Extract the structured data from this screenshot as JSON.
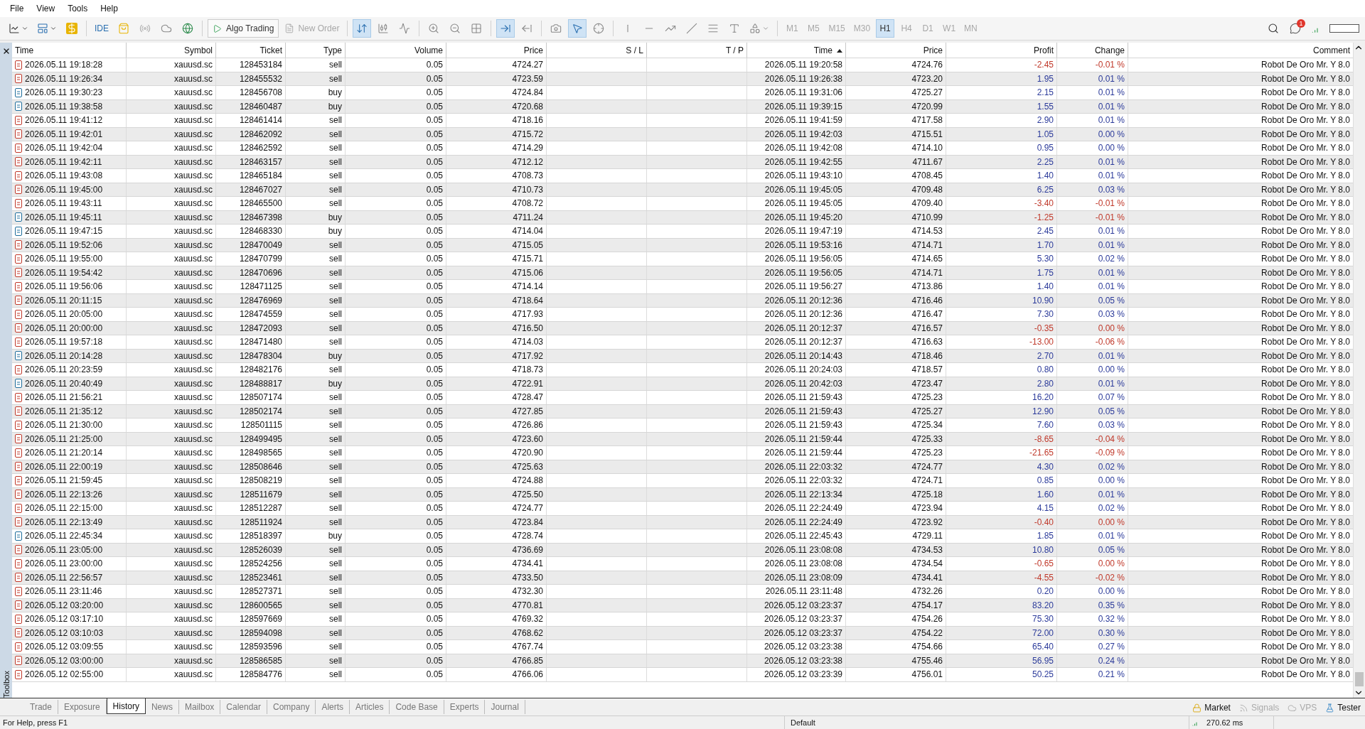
{
  "menu": [
    "File",
    "View",
    "Tools",
    "Help"
  ],
  "toolbar": {
    "ide": "IDE",
    "algo_trading": "Algo Trading",
    "new_order": {
      "label": "New Order",
      "disabled": true
    },
    "timeframes": [
      {
        "label": "M1",
        "selected": false
      },
      {
        "label": "M5",
        "selected": false
      },
      {
        "label": "M15",
        "selected": false
      },
      {
        "label": "M30",
        "selected": false
      },
      {
        "label": "H1",
        "selected": true
      },
      {
        "label": "H4",
        "selected": false
      },
      {
        "label": "D1",
        "selected": false
      },
      {
        "label": "W1",
        "selected": false
      },
      {
        "label": "MN",
        "selected": false
      }
    ],
    "notification_badge": "1"
  },
  "toolbox_label": "Toolbox",
  "table": {
    "columns": [
      {
        "label": "Time",
        "sorted": false
      },
      {
        "label": "Symbol",
        "sorted": false
      },
      {
        "label": "Ticket",
        "sorted": false
      },
      {
        "label": "Type",
        "sorted": false
      },
      {
        "label": "Volume",
        "sorted": false
      },
      {
        "label": "Price",
        "sorted": false
      },
      {
        "label": "S / L",
        "sorted": false
      },
      {
        "label": "T / P",
        "sorted": false
      },
      {
        "label": "Time",
        "sorted": true
      },
      {
        "label": "Price",
        "sorted": false
      },
      {
        "label": "Profit",
        "sorted": false
      },
      {
        "label": "Change",
        "sorted": false
      },
      {
        "label": "Comment",
        "sorted": false
      }
    ],
    "rows": [
      {
        "kind": "sell",
        "open_time": "2026.05.11 19:18:28",
        "symbol": "xauusd.sc",
        "ticket": "128453184",
        "type": "sell",
        "volume": "0.05",
        "open_price": "4724.27",
        "close_time": "2026.05.11 19:20:58",
        "close_price": "4724.76",
        "profit": "-2.45",
        "change": "-0.01 %",
        "loss": true,
        "comment": "Robot De Oro Mr. Y 8.0"
      },
      {
        "kind": "sell",
        "open_time": "2026.05.11 19:26:34",
        "symbol": "xauusd.sc",
        "ticket": "128455532",
        "type": "sell",
        "volume": "0.05",
        "open_price": "4723.59",
        "close_time": "2026.05.11 19:26:38",
        "close_price": "4723.20",
        "profit": "1.95",
        "change": "0.01 %",
        "loss": false,
        "comment": "Robot De Oro Mr. Y 8.0"
      },
      {
        "kind": "buy",
        "open_time": "2026.05.11 19:30:23",
        "symbol": "xauusd.sc",
        "ticket": "128456708",
        "type": "buy",
        "volume": "0.05",
        "open_price": "4724.84",
        "close_time": "2026.05.11 19:31:06",
        "close_price": "4725.27",
        "profit": "2.15",
        "change": "0.01 %",
        "loss": false,
        "comment": "Robot De Oro Mr. Y 8.0"
      },
      {
        "kind": "buy",
        "open_time": "2026.05.11 19:38:58",
        "symbol": "xauusd.sc",
        "ticket": "128460487",
        "type": "buy",
        "volume": "0.05",
        "open_price": "4720.68",
        "close_time": "2026.05.11 19:39:15",
        "close_price": "4720.99",
        "profit": "1.55",
        "change": "0.01 %",
        "loss": false,
        "comment": "Robot De Oro Mr. Y 8.0"
      },
      {
        "kind": "sell",
        "open_time": "2026.05.11 19:41:12",
        "symbol": "xauusd.sc",
        "ticket": "128461414",
        "type": "sell",
        "volume": "0.05",
        "open_price": "4718.16",
        "close_time": "2026.05.11 19:41:59",
        "close_price": "4717.58",
        "profit": "2.90",
        "change": "0.01 %",
        "loss": false,
        "comment": "Robot De Oro Mr. Y 8.0"
      },
      {
        "kind": "sell",
        "open_time": "2026.05.11 19:42:01",
        "symbol": "xauusd.sc",
        "ticket": "128462092",
        "type": "sell",
        "volume": "0.05",
        "open_price": "4715.72",
        "close_time": "2026.05.11 19:42:03",
        "close_price": "4715.51",
        "profit": "1.05",
        "change": "0.00 %",
        "loss": false,
        "comment": "Robot De Oro Mr. Y 8.0"
      },
      {
        "kind": "sell",
        "open_time": "2026.05.11 19:42:04",
        "symbol": "xauusd.sc",
        "ticket": "128462592",
        "type": "sell",
        "volume": "0.05",
        "open_price": "4714.29",
        "close_time": "2026.05.11 19:42:08",
        "close_price": "4714.10",
        "profit": "0.95",
        "change": "0.00 %",
        "loss": false,
        "comment": "Robot De Oro Mr. Y 8.0"
      },
      {
        "kind": "sell",
        "open_time": "2026.05.11 19:42:11",
        "symbol": "xauusd.sc",
        "ticket": "128463157",
        "type": "sell",
        "volume": "0.05",
        "open_price": "4712.12",
        "close_time": "2026.05.11 19:42:55",
        "close_price": "4711.67",
        "profit": "2.25",
        "change": "0.01 %",
        "loss": false,
        "comment": "Robot De Oro Mr. Y 8.0"
      },
      {
        "kind": "sell",
        "open_time": "2026.05.11 19:43:08",
        "symbol": "xauusd.sc",
        "ticket": "128465184",
        "type": "sell",
        "volume": "0.05",
        "open_price": "4708.73",
        "close_time": "2026.05.11 19:43:10",
        "close_price": "4708.45",
        "profit": "1.40",
        "change": "0.01 %",
        "loss": false,
        "comment": "Robot De Oro Mr. Y 8.0"
      },
      {
        "kind": "sell",
        "open_time": "2026.05.11 19:45:00",
        "symbol": "xauusd.sc",
        "ticket": "128467027",
        "type": "sell",
        "volume": "0.05",
        "open_price": "4710.73",
        "close_time": "2026.05.11 19:45:05",
        "close_price": "4709.48",
        "profit": "6.25",
        "change": "0.03 %",
        "loss": false,
        "comment": "Robot De Oro Mr. Y 8.0"
      },
      {
        "kind": "sell",
        "open_time": "2026.05.11 19:43:11",
        "symbol": "xauusd.sc",
        "ticket": "128465500",
        "type": "sell",
        "volume": "0.05",
        "open_price": "4708.72",
        "close_time": "2026.05.11 19:45:05",
        "close_price": "4709.40",
        "profit": "-3.40",
        "change": "-0.01 %",
        "loss": true,
        "comment": "Robot De Oro Mr. Y 8.0"
      },
      {
        "kind": "buy",
        "open_time": "2026.05.11 19:45:11",
        "symbol": "xauusd.sc",
        "ticket": "128467398",
        "type": "buy",
        "volume": "0.05",
        "open_price": "4711.24",
        "close_time": "2026.05.11 19:45:20",
        "close_price": "4710.99",
        "profit": "-1.25",
        "change": "-0.01 %",
        "loss": true,
        "comment": "Robot De Oro Mr. Y 8.0"
      },
      {
        "kind": "buy",
        "open_time": "2026.05.11 19:47:15",
        "symbol": "xauusd.sc",
        "ticket": "128468330",
        "type": "buy",
        "volume": "0.05",
        "open_price": "4714.04",
        "close_time": "2026.05.11 19:47:19",
        "close_price": "4714.53",
        "profit": "2.45",
        "change": "0.01 %",
        "loss": false,
        "comment": "Robot De Oro Mr. Y 8.0"
      },
      {
        "kind": "sell",
        "open_time": "2026.05.11 19:52:06",
        "symbol": "xauusd.sc",
        "ticket": "128470049",
        "type": "sell",
        "volume": "0.05",
        "open_price": "4715.05",
        "close_time": "2026.05.11 19:53:16",
        "close_price": "4714.71",
        "profit": "1.70",
        "change": "0.01 %",
        "loss": false,
        "comment": "Robot De Oro Mr. Y 8.0"
      },
      {
        "kind": "sell",
        "open_time": "2026.05.11 19:55:00",
        "symbol": "xauusd.sc",
        "ticket": "128470799",
        "type": "sell",
        "volume": "0.05",
        "open_price": "4715.71",
        "close_time": "2026.05.11 19:56:05",
        "close_price": "4714.65",
        "profit": "5.30",
        "change": "0.02 %",
        "loss": false,
        "comment": "Robot De Oro Mr. Y 8.0"
      },
      {
        "kind": "sell",
        "open_time": "2026.05.11 19:54:42",
        "symbol": "xauusd.sc",
        "ticket": "128470696",
        "type": "sell",
        "volume": "0.05",
        "open_price": "4715.06",
        "close_time": "2026.05.11 19:56:05",
        "close_price": "4714.71",
        "profit": "1.75",
        "change": "0.01 %",
        "loss": false,
        "comment": "Robot De Oro Mr. Y 8.0"
      },
      {
        "kind": "sell",
        "open_time": "2026.05.11 19:56:06",
        "symbol": "xauusd.sc",
        "ticket": "128471125",
        "type": "sell",
        "volume": "0.05",
        "open_price": "4714.14",
        "close_time": "2026.05.11 19:56:27",
        "close_price": "4713.86",
        "profit": "1.40",
        "change": "0.01 %",
        "loss": false,
        "comment": "Robot De Oro Mr. Y 8.0"
      },
      {
        "kind": "sell",
        "open_time": "2026.05.11 20:11:15",
        "symbol": "xauusd.sc",
        "ticket": "128476969",
        "type": "sell",
        "volume": "0.05",
        "open_price": "4718.64",
        "close_time": "2026.05.11 20:12:36",
        "close_price": "4716.46",
        "profit": "10.90",
        "change": "0.05 %",
        "loss": false,
        "comment": "Robot De Oro Mr. Y 8.0"
      },
      {
        "kind": "sell",
        "open_time": "2026.05.11 20:05:00",
        "symbol": "xauusd.sc",
        "ticket": "128474559",
        "type": "sell",
        "volume": "0.05",
        "open_price": "4717.93",
        "close_time": "2026.05.11 20:12:36",
        "close_price": "4716.47",
        "profit": "7.30",
        "change": "0.03 %",
        "loss": false,
        "comment": "Robot De Oro Mr. Y 8.0"
      },
      {
        "kind": "sell",
        "open_time": "2026.05.11 20:00:00",
        "symbol": "xauusd.sc",
        "ticket": "128472093",
        "type": "sell",
        "volume": "0.05",
        "open_price": "4716.50",
        "close_time": "2026.05.11 20:12:37",
        "close_price": "4716.57",
        "profit": "-0.35",
        "change": "0.00 %",
        "loss": true,
        "comment": "Robot De Oro Mr. Y 8.0"
      },
      {
        "kind": "sell",
        "open_time": "2026.05.11 19:57:18",
        "symbol": "xauusd.sc",
        "ticket": "128471480",
        "type": "sell",
        "volume": "0.05",
        "open_price": "4714.03",
        "close_time": "2026.05.11 20:12:37",
        "close_price": "4716.63",
        "profit": "-13.00",
        "change": "-0.06 %",
        "loss": true,
        "comment": "Robot De Oro Mr. Y 8.0"
      },
      {
        "kind": "buy",
        "open_time": "2026.05.11 20:14:28",
        "symbol": "xauusd.sc",
        "ticket": "128478304",
        "type": "buy",
        "volume": "0.05",
        "open_price": "4717.92",
        "close_time": "2026.05.11 20:14:43",
        "close_price": "4718.46",
        "profit": "2.70",
        "change": "0.01 %",
        "loss": false,
        "comment": "Robot De Oro Mr. Y 8.0"
      },
      {
        "kind": "sell",
        "open_time": "2026.05.11 20:23:59",
        "symbol": "xauusd.sc",
        "ticket": "128482176",
        "type": "sell",
        "volume": "0.05",
        "open_price": "4718.73",
        "close_time": "2026.05.11 20:24:03",
        "close_price": "4718.57",
        "profit": "0.80",
        "change": "0.00 %",
        "loss": false,
        "comment": "Robot De Oro Mr. Y 8.0"
      },
      {
        "kind": "buy",
        "open_time": "2026.05.11 20:40:49",
        "symbol": "xauusd.sc",
        "ticket": "128488817",
        "type": "buy",
        "volume": "0.05",
        "open_price": "4722.91",
        "close_time": "2026.05.11 20:42:03",
        "close_price": "4723.47",
        "profit": "2.80",
        "change": "0.01 %",
        "loss": false,
        "comment": "Robot De Oro Mr. Y 8.0"
      },
      {
        "kind": "sell",
        "open_time": "2026.05.11 21:56:21",
        "symbol": "xauusd.sc",
        "ticket": "128507174",
        "type": "sell",
        "volume": "0.05",
        "open_price": "4728.47",
        "close_time": "2026.05.11 21:59:43",
        "close_price": "4725.23",
        "profit": "16.20",
        "change": "0.07 %",
        "loss": false,
        "comment": "Robot De Oro Mr. Y 8.0"
      },
      {
        "kind": "sell",
        "open_time": "2026.05.11 21:35:12",
        "symbol": "xauusd.sc",
        "ticket": "128502174",
        "type": "sell",
        "volume": "0.05",
        "open_price": "4727.85",
        "close_time": "2026.05.11 21:59:43",
        "close_price": "4725.27",
        "profit": "12.90",
        "change": "0.05 %",
        "loss": false,
        "comment": "Robot De Oro Mr. Y 8.0"
      },
      {
        "kind": "sell",
        "open_time": "2026.05.11 21:30:00",
        "symbol": "xauusd.sc",
        "ticket": "128501115",
        "type": "sell",
        "volume": "0.05",
        "open_price": "4726.86",
        "close_time": "2026.05.11 21:59:43",
        "close_price": "4725.34",
        "profit": "7.60",
        "change": "0.03 %",
        "loss": false,
        "comment": "Robot De Oro Mr. Y 8.0"
      },
      {
        "kind": "sell",
        "open_time": "2026.05.11 21:25:00",
        "symbol": "xauusd.sc",
        "ticket": "128499495",
        "type": "sell",
        "volume": "0.05",
        "open_price": "4723.60",
        "close_time": "2026.05.11 21:59:44",
        "close_price": "4725.33",
        "profit": "-8.65",
        "change": "-0.04 %",
        "loss": true,
        "comment": "Robot De Oro Mr. Y 8.0"
      },
      {
        "kind": "sell",
        "open_time": "2026.05.11 21:20:14",
        "symbol": "xauusd.sc",
        "ticket": "128498565",
        "type": "sell",
        "volume": "0.05",
        "open_price": "4720.90",
        "close_time": "2026.05.11 21:59:44",
        "close_price": "4725.23",
        "profit": "-21.65",
        "change": "-0.09 %",
        "loss": true,
        "comment": "Robot De Oro Mr. Y 8.0"
      },
      {
        "kind": "sell",
        "open_time": "2026.05.11 22:00:19",
        "symbol": "xauusd.sc",
        "ticket": "128508646",
        "type": "sell",
        "volume": "0.05",
        "open_price": "4725.63",
        "close_time": "2026.05.11 22:03:32",
        "close_price": "4724.77",
        "profit": "4.30",
        "change": "0.02 %",
        "loss": false,
        "comment": "Robot De Oro Mr. Y 8.0"
      },
      {
        "kind": "sell",
        "open_time": "2026.05.11 21:59:45",
        "symbol": "xauusd.sc",
        "ticket": "128508219",
        "type": "sell",
        "volume": "0.05",
        "open_price": "4724.88",
        "close_time": "2026.05.11 22:03:32",
        "close_price": "4724.71",
        "profit": "0.85",
        "change": "0.00 %",
        "loss": false,
        "comment": "Robot De Oro Mr. Y 8.0"
      },
      {
        "kind": "sell",
        "open_time": "2026.05.11 22:13:26",
        "symbol": "xauusd.sc",
        "ticket": "128511679",
        "type": "sell",
        "volume": "0.05",
        "open_price": "4725.50",
        "close_time": "2026.05.11 22:13:34",
        "close_price": "4725.18",
        "profit": "1.60",
        "change": "0.01 %",
        "loss": false,
        "comment": "Robot De Oro Mr. Y 8.0"
      },
      {
        "kind": "sell",
        "open_time": "2026.05.11 22:15:00",
        "symbol": "xauusd.sc",
        "ticket": "128512287",
        "type": "sell",
        "volume": "0.05",
        "open_price": "4724.77",
        "close_time": "2026.05.11 22:24:49",
        "close_price": "4723.94",
        "profit": "4.15",
        "change": "0.02 %",
        "loss": false,
        "comment": "Robot De Oro Mr. Y 8.0"
      },
      {
        "kind": "sell",
        "open_time": "2026.05.11 22:13:49",
        "symbol": "xauusd.sc",
        "ticket": "128511924",
        "type": "sell",
        "volume": "0.05",
        "open_price": "4723.84",
        "close_time": "2026.05.11 22:24:49",
        "close_price": "4723.92",
        "profit": "-0.40",
        "change": "0.00 %",
        "loss": true,
        "comment": "Robot De Oro Mr. Y 8.0"
      },
      {
        "kind": "buy",
        "open_time": "2026.05.11 22:45:34",
        "symbol": "xauusd.sc",
        "ticket": "128518397",
        "type": "buy",
        "volume": "0.05",
        "open_price": "4728.74",
        "close_time": "2026.05.11 22:45:43",
        "close_price": "4729.11",
        "profit": "1.85",
        "change": "0.01 %",
        "loss": false,
        "comment": "Robot De Oro Mr. Y 8.0"
      },
      {
        "kind": "sell",
        "open_time": "2026.05.11 23:05:00",
        "symbol": "xauusd.sc",
        "ticket": "128526039",
        "type": "sell",
        "volume": "0.05",
        "open_price": "4736.69",
        "close_time": "2026.05.11 23:08:08",
        "close_price": "4734.53",
        "profit": "10.80",
        "change": "0.05 %",
        "loss": false,
        "comment": "Robot De Oro Mr. Y 8.0"
      },
      {
        "kind": "sell",
        "open_time": "2026.05.11 23:00:00",
        "symbol": "xauusd.sc",
        "ticket": "128524256",
        "type": "sell",
        "volume": "0.05",
        "open_price": "4734.41",
        "close_time": "2026.05.11 23:08:08",
        "close_price": "4734.54",
        "profit": "-0.65",
        "change": "0.00 %",
        "loss": true,
        "comment": "Robot De Oro Mr. Y 8.0"
      },
      {
        "kind": "sell",
        "open_time": "2026.05.11 22:56:57",
        "symbol": "xauusd.sc",
        "ticket": "128523461",
        "type": "sell",
        "volume": "0.05",
        "open_price": "4733.50",
        "close_time": "2026.05.11 23:08:09",
        "close_price": "4734.41",
        "profit": "-4.55",
        "change": "-0.02 %",
        "loss": true,
        "comment": "Robot De Oro Mr. Y 8.0"
      },
      {
        "kind": "sell",
        "open_time": "2026.05.11 23:11:46",
        "symbol": "xauusd.sc",
        "ticket": "128527371",
        "type": "sell",
        "volume": "0.05",
        "open_price": "4732.30",
        "close_time": "2026.05.11 23:11:48",
        "close_price": "4732.26",
        "profit": "0.20",
        "change": "0.00 %",
        "loss": false,
        "comment": "Robot De Oro Mr. Y 8.0"
      },
      {
        "kind": "sell",
        "open_time": "2026.05.12 03:20:00",
        "symbol": "xauusd.sc",
        "ticket": "128600565",
        "type": "sell",
        "volume": "0.05",
        "open_price": "4770.81",
        "close_time": "2026.05.12 03:23:37",
        "close_price": "4754.17",
        "profit": "83.20",
        "change": "0.35 %",
        "loss": false,
        "comment": "Robot De Oro Mr. Y 8.0"
      },
      {
        "kind": "sell",
        "open_time": "2026.05.12 03:17:10",
        "symbol": "xauusd.sc",
        "ticket": "128597669",
        "type": "sell",
        "volume": "0.05",
        "open_price": "4769.32",
        "close_time": "2026.05.12 03:23:37",
        "close_price": "4754.26",
        "profit": "75.30",
        "change": "0.32 %",
        "loss": false,
        "comment": "Robot De Oro Mr. Y 8.0"
      },
      {
        "kind": "sell",
        "open_time": "2026.05.12 03:10:03",
        "symbol": "xauusd.sc",
        "ticket": "128594098",
        "type": "sell",
        "volume": "0.05",
        "open_price": "4768.62",
        "close_time": "2026.05.12 03:23:37",
        "close_price": "4754.22",
        "profit": "72.00",
        "change": "0.30 %",
        "loss": false,
        "comment": "Robot De Oro Mr. Y 8.0"
      },
      {
        "kind": "sell",
        "open_time": "2026.05.12 03:09:55",
        "symbol": "xauusd.sc",
        "ticket": "128593596",
        "type": "sell",
        "volume": "0.05",
        "open_price": "4767.74",
        "close_time": "2026.05.12 03:23:38",
        "close_price": "4754.66",
        "profit": "65.40",
        "change": "0.27 %",
        "loss": false,
        "comment": "Robot De Oro Mr. Y 8.0"
      },
      {
        "kind": "sell",
        "open_time": "2026.05.12 03:00:00",
        "symbol": "xauusd.sc",
        "ticket": "128586585",
        "type": "sell",
        "volume": "0.05",
        "open_price": "4766.85",
        "close_time": "2026.05.12 03:23:38",
        "close_price": "4755.46",
        "profit": "56.95",
        "change": "0.24 %",
        "loss": false,
        "comment": "Robot De Oro Mr. Y 8.0"
      },
      {
        "kind": "sell",
        "open_time": "2026.05.12 02:55:00",
        "symbol": "xauusd.sc",
        "ticket": "128584776",
        "type": "sell",
        "volume": "0.05",
        "open_price": "4766.06",
        "close_time": "2026.05.12 03:23:39",
        "close_price": "4756.01",
        "profit": "50.25",
        "change": "0.21 %",
        "loss": false,
        "comment": "Robot De Oro Mr. Y 8.0"
      }
    ]
  },
  "bottom_tabs": [
    {
      "label": "Trade",
      "selected": false
    },
    {
      "label": "Exposure",
      "selected": false
    },
    {
      "label": "History",
      "selected": true
    },
    {
      "label": "News",
      "selected": false
    },
    {
      "label": "Mailbox",
      "selected": false
    },
    {
      "label": "Calendar",
      "selected": false
    },
    {
      "label": "Company",
      "selected": false
    },
    {
      "label": "Alerts",
      "selected": false
    },
    {
      "label": "Articles",
      "selected": false
    },
    {
      "label": "Code Base",
      "selected": false
    },
    {
      "label": "Experts",
      "selected": false
    },
    {
      "label": "Journal",
      "selected": false
    }
  ],
  "services": [
    {
      "kind": "market",
      "label": "Market",
      "enabled": true
    },
    {
      "kind": "signals",
      "label": "Signals",
      "enabled": false
    },
    {
      "kind": "vps",
      "label": "VPS",
      "enabled": false
    },
    {
      "kind": "tester",
      "label": "Tester",
      "enabled": true
    }
  ],
  "status_bar": {
    "help": "For Help, press F1",
    "profile": "Default",
    "ping": "270.62 ms"
  }
}
